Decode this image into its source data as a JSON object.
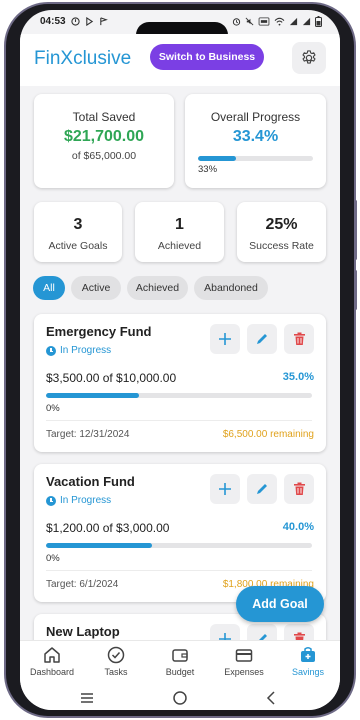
{
  "status_bar": {
    "time": "04:53",
    "icons": [
      "alarm-icon",
      "mute-icon",
      "volte-icon",
      "wifi-icon",
      "signal-icon",
      "signal-icon",
      "battery-icon"
    ]
  },
  "header": {
    "brand": "FinXclusive",
    "switch_button": "Switch to Business",
    "settings_icon": "gear-icon"
  },
  "summary": {
    "total_saved": {
      "title": "Total Saved",
      "value": "$21,700.00",
      "sub": "of $65,000.00"
    },
    "overall_progress": {
      "title": "Overall Progress",
      "value": "33.4%",
      "bar_label": "33%",
      "fraction": 0.334
    }
  },
  "stats": [
    {
      "value": "3",
      "label": "Active Goals"
    },
    {
      "value": "1",
      "label": "Achieved"
    },
    {
      "value": "25%",
      "label": "Success Rate"
    }
  ],
  "filters": [
    {
      "label": "All",
      "active": true
    },
    {
      "label": "Active",
      "active": false
    },
    {
      "label": "Achieved",
      "active": false
    },
    {
      "label": "Abandoned",
      "active": false
    }
  ],
  "goals": [
    {
      "name": "Emergency Fund",
      "status": "In Progress",
      "amount": "$3,500.00 of $10,000.00",
      "percent": "35.0%",
      "bar_label": "0%",
      "fraction": 0.35,
      "target": "Target: 12/31/2024",
      "remaining": "$6,500.00 remaining"
    },
    {
      "name": "Vacation Fund",
      "status": "In Progress",
      "amount": "$1,200.00 of $3,000.00",
      "percent": "40.0%",
      "bar_label": "0%",
      "fraction": 0.4,
      "target": "Target: 6/1/2024",
      "remaining": "$1,800.00 remaining"
    },
    {
      "name": "New Laptop"
    }
  ],
  "fab_label": "Add Goal",
  "bottom_nav": [
    {
      "label": "Dashboard",
      "icon": "home-icon",
      "active": false
    },
    {
      "label": "Tasks",
      "icon": "check-circle-icon",
      "active": false
    },
    {
      "label": "Budget",
      "icon": "wallet-icon",
      "active": false
    },
    {
      "label": "Expenses",
      "icon": "card-icon",
      "active": false
    },
    {
      "label": "Savings",
      "icon": "savings-icon",
      "active": true
    }
  ],
  "colors": {
    "accent": "#2596d4",
    "brand_purple": "#7b3fe4",
    "success": "#2fa655",
    "warning": "#e0a21c",
    "danger": "#e0484a"
  }
}
